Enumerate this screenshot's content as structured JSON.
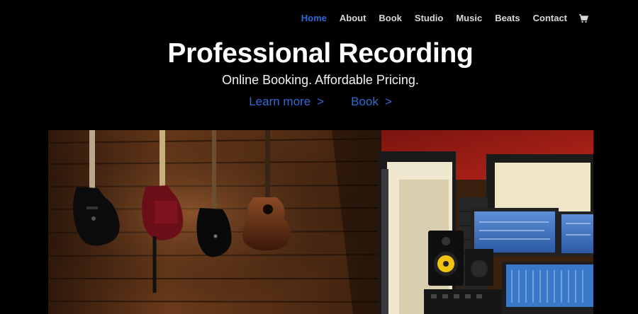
{
  "nav": {
    "items": [
      {
        "label": "Home",
        "active": true
      },
      {
        "label": "About",
        "active": false
      },
      {
        "label": "Book",
        "active": false
      },
      {
        "label": "Studio",
        "active": false
      },
      {
        "label": "Music",
        "active": false
      },
      {
        "label": "Beats",
        "active": false
      },
      {
        "label": "Contact",
        "active": false
      }
    ],
    "cart_icon": "cart-icon"
  },
  "hero": {
    "title": "Professional Recording",
    "subtitle": "Online Booking. Affordable Pricing.",
    "learn_more": "Learn more",
    "book": "Book",
    "chevron": ">"
  },
  "colors": {
    "background": "#000000",
    "accent": "#2f6bd8",
    "nav_text": "#d8d8d8",
    "title": "#ffffff"
  },
  "photo": {
    "subject": "studio-photo"
  }
}
